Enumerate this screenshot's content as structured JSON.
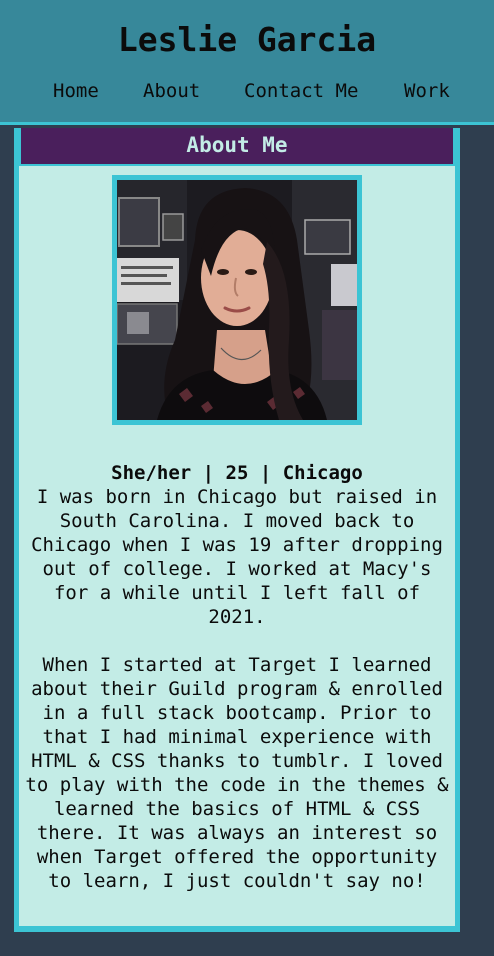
{
  "header": {
    "title": "Leslie Garcia",
    "nav": [
      "Home",
      "About",
      "Contact Me",
      "Work"
    ]
  },
  "card": {
    "heading": "About Me",
    "photo_alt": "profile-photo",
    "tagline": "She/her | 25 | Chicago",
    "paragraphs": [
      "I was born in Chicago but raised in South Carolina. I moved back to Chicago when I was 19 after dropping out of college. I worked at Macy's for a while until I left fall of 2021.",
      "When I started at Target I learned about their Guild program & enrolled in a full stack bootcamp. Prior to that I had minimal experience with HTML & CSS thanks to tumblr. I loved to play with the code in the themes & learned the basics of HTML & CSS there. It was always an interest so when Target offered the opportunity to learn, I just couldn't say no!"
    ]
  },
  "colors": {
    "page_background": "#2f3e4f",
    "header_background": "#37889a",
    "accent": "#3cc4d4",
    "card_heading_background": "#4a1f5c",
    "card_background": "#c3ece6"
  }
}
